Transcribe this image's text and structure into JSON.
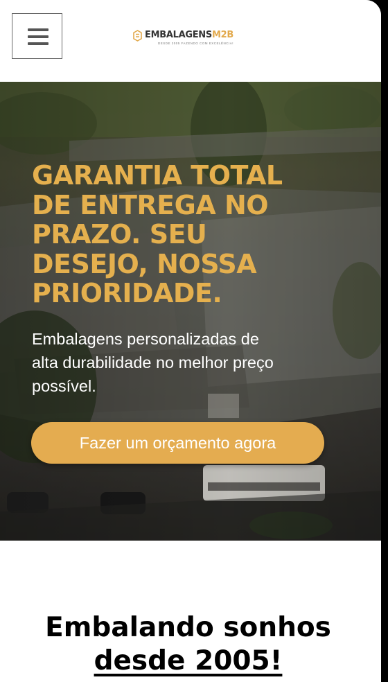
{
  "header": {
    "menu_icon": "hamburger-menu-icon",
    "logo": {
      "name_main": "EMBALAGENS",
      "name_accent": "M2B",
      "tagline": "DESDE 2005 FAZENDO COM EXCELÊNCIA!",
      "accent_color": "#e2a94c"
    }
  },
  "hero": {
    "title_lines": [
      "GARANTIA TOTAL",
      "DE ENTREGA NO",
      "PRAZO. SEU",
      "DESEJO, NOSSA",
      "PRIORIDADE."
    ],
    "subtitle_lines": [
      "Embalagens personalizadas de",
      "alta durabilidade no melhor preço",
      "possível."
    ],
    "cta_label": "Fazer um orçamento agora",
    "title_color": "#e5b04e",
    "cta_color": "#e4ac50"
  },
  "section": {
    "title_line1": "Embalando sonhos",
    "title_line2": "desde 2005!"
  }
}
